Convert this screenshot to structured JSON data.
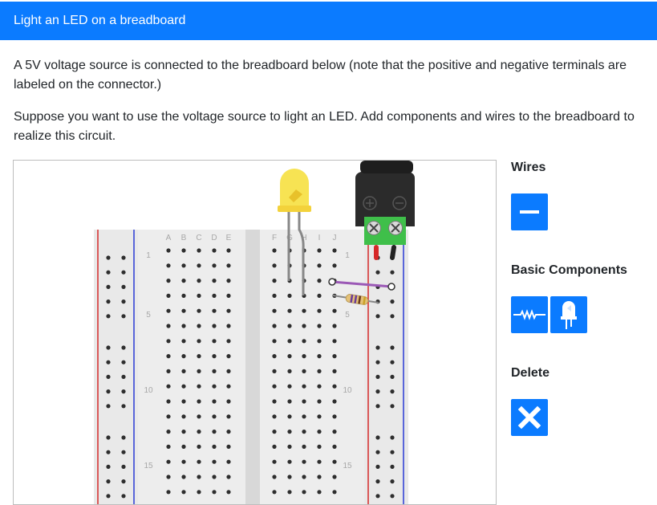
{
  "header": {
    "title": "Light an LED on a breadboard"
  },
  "instructions": {
    "p1": "A 5V voltage source is connected to the breadboard below (note that the positive and negative terminals are labeled on the connector.)",
    "p2": "Suppose you want to use the voltage source to light an LED. Add components and wires to the breadboard to realize this circuit."
  },
  "breadboard": {
    "column_letters_left": [
      "A",
      "B",
      "C",
      "D",
      "E"
    ],
    "column_letters_right": [
      "F",
      "G",
      "H",
      "I",
      "J"
    ],
    "row_numbers": [
      "1",
      "5",
      "10",
      "15"
    ],
    "connector_terminals": [
      "+",
      "−"
    ],
    "placed_components": [
      "led",
      "resistor",
      "wire"
    ],
    "colors": {
      "led": "#f7e14a",
      "wire": "#9b59b6",
      "connector_body": "#2b2b2b",
      "terminal_block": "#3fbf4a",
      "positive_wire": "#d62828",
      "negative_wire": "#222222",
      "rail_positive": "#d62828",
      "rail_negative": "#2b3bd6"
    }
  },
  "tools": {
    "wires_title": "Wires",
    "basic_components_title": "Basic Components",
    "delete_title": "Delete",
    "wire_button": "wire-tool",
    "resistor_button": "resistor-tool",
    "led_button": "led-tool",
    "delete_button": "delete-tool"
  },
  "icons": {
    "wire": "minus-icon",
    "resistor": "resistor-icon",
    "led": "led-icon",
    "delete": "close-icon"
  }
}
